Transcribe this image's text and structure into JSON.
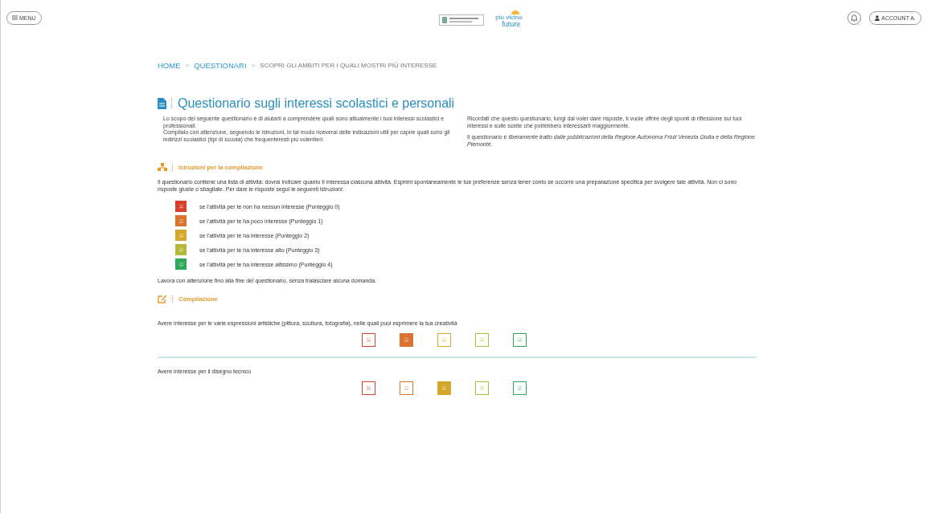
{
  "header": {
    "menu_label": "MENU",
    "logo_text": [
      "più vicino",
      "future"
    ],
    "user_label": "ACCOUNT A."
  },
  "breadcrumb": [
    {
      "label": "HOME",
      "kind": "link"
    },
    {
      "label": ">",
      "kind": "sep"
    },
    {
      "label": "QUESTIONARI",
      "kind": "link"
    },
    {
      "label": ">",
      "kind": "sep"
    },
    {
      "label": "SCOPRI GLI AMBITI PER I QUALI MOSTRI PIÙ INTERESSE",
      "kind": "current"
    }
  ],
  "title": "Questionario sugli interessi scolastici e personali",
  "intro_left": [
    "Lo scopo del seguente questionario è di aiutarti a comprendere quali sono attualmente i tuoi interessi scolastici e professionali.",
    "Compilalo con attenzione, seguendo le istruzioni, in tal modo riceverai delle indicazioni utili per capire quali sono gli indirizzi scolastici (tipi di scuola) che frequenteresti più volentieri."
  ],
  "intro_right": [
    "Ricordati che questo questionario, lungi dal voler dare risposte, ti vuole offrire degli spunti di riflessione sui tuoi interessi e sulle scelte che potrebbero interessarti maggiormente.",
    "Il questionario è *liberamente tratto dalle pubblicazioni della Regione Autonoma Friuli Venezia Giulia e della Regione Piemonte.*"
  ],
  "instructions": {
    "heading": "Istruzioni per la compilazione",
    "text": "Il questionario contiene una lista di attività: dovrai indicare quanto ti interessa ciascuna attività. Esprimi spontaneamente le tue preferenze senza tener conto se occorre una preparazione specifica per svolgere tale attività. Non ci sono risposte giuste o sbagliate. Per dare le risposte segui le seguenti istruzioni:",
    "legend": [
      {
        "text": "se l'attività per te non ha nessun interesse (Punteggio 0)",
        "color": "#d6402e"
      },
      {
        "text": "se l'attività per te ha poco interesse (Punteggio 1)",
        "color": "#dc7431"
      },
      {
        "text": "se l'attività per te ha interesse (Punteggio 2)",
        "color": "#d3a62c"
      },
      {
        "text": "se l'attività per te ha interesse alto (Punteggio 3)",
        "color": "#b4b83a"
      },
      {
        "text": "se l'attività per te ha interesse altissimo (Punteggio 4)",
        "color": "#2fa85c"
      }
    ],
    "note": "Lavora con attenzione fino alla fine del questionario, senza tralasciare alcuna domanda."
  },
  "compilation": {
    "heading": "Compilazione",
    "questions": [
      {
        "text": "Avere interesse per le varie espressioni artistiche (pittura, scultura, fotografia), nelle quali puoi esprimere la tua creatività",
        "options": [
          {
            "selected": false
          },
          {
            "selected": true
          },
          {
            "selected": false
          },
          {
            "selected": false
          },
          {
            "selected": false
          }
        ]
      },
      {
        "text": "Avere interesse per il disegno tecnico",
        "options": [
          {
            "selected": false
          },
          {
            "selected": false
          },
          {
            "selected": true
          },
          {
            "selected": false
          },
          {
            "selected": false
          }
        ]
      }
    ]
  }
}
